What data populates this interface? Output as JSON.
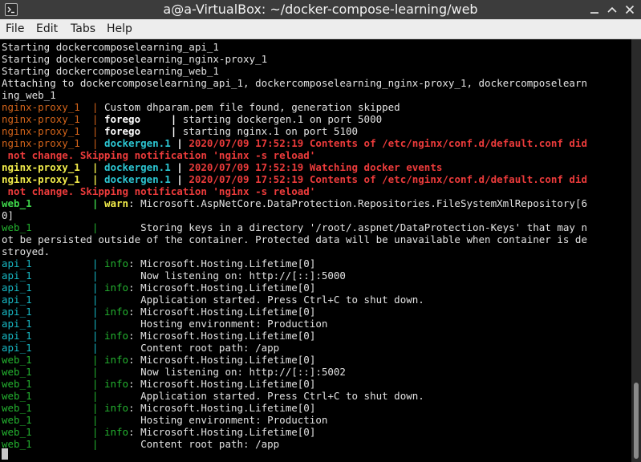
{
  "window": {
    "title": "a@a-VirtualBox: ~/docker-compose-learning/web"
  },
  "menu": {
    "file": "File",
    "edit": "Edit",
    "tabs": "Tabs",
    "help": "Help"
  },
  "icons": {
    "app": "terminal-icon",
    "minimize": "minimize-icon",
    "maximize": "maximize-icon",
    "close": "close-icon"
  },
  "colors": {
    "nginx_proxy_prefix": "#d4641a",
    "api_prefix": "#17b8c4",
    "web_prefix": "#23b12f",
    "error_text": "#ec3b3b",
    "highlight_yellow": "#f2ec4a"
  },
  "terminal": {
    "lines": [
      [
        {
          "t": "Starting dockercomposelearning_api_1",
          "c": "white"
        }
      ],
      [
        {
          "t": "Starting dockercomposelearning_nginx-proxy_1",
          "c": "white"
        }
      ],
      [
        {
          "t": "Starting dockercomposelearning_web_1",
          "c": "white"
        }
      ],
      [
        {
          "t": "Attaching to dockercomposelearning_api_1, dockercomposelearning_nginx-proxy_1, dockercomposelearn",
          "c": "white"
        }
      ],
      [
        {
          "t": "ing_web_1",
          "c": "white"
        }
      ],
      [
        {
          "t": "nginx-proxy_1  | ",
          "c": "orange"
        },
        {
          "t": "Custom dhparam.pem file found, generation skipped",
          "c": "white"
        }
      ],
      [
        {
          "t": "nginx-proxy_1  | ",
          "c": "orange"
        },
        {
          "t": "forego",
          "c": "whiteb"
        },
        {
          "t": "     | ",
          "c": "whiteb"
        },
        {
          "t": "starting dockergen.1 on port 5000",
          "c": "white"
        }
      ],
      [
        {
          "t": "nginx-proxy_1  | ",
          "c": "orange"
        },
        {
          "t": "forego",
          "c": "whiteb"
        },
        {
          "t": "     | ",
          "c": "whiteb"
        },
        {
          "t": "starting nginx.1 on port 5100",
          "c": "white"
        }
      ],
      [
        {
          "t": "nginx-proxy_1  | ",
          "c": "orange"
        },
        {
          "t": "dockergen.1",
          "c": "cyanb"
        },
        {
          "t": " | ",
          "c": "whiteb"
        },
        {
          "t": "2020/07/09 17:52:19 Contents of /etc/nginx/conf.d/default.conf did",
          "c": "red"
        }
      ],
      [
        {
          "t": " not change. Skipping notification 'nginx -s reload'",
          "c": "red"
        }
      ],
      [
        {
          "t": "nginx-proxy_1  | ",
          "c": "yellow"
        },
        {
          "t": "dockergen.1",
          "c": "cyanb"
        },
        {
          "t": " | ",
          "c": "whiteb"
        },
        {
          "t": "2020/07/09 17:52:19 Watching docker events",
          "c": "red"
        }
      ],
      [
        {
          "t": "nginx-proxy_1  | ",
          "c": "yellow"
        },
        {
          "t": "dockergen.1",
          "c": "cyanb"
        },
        {
          "t": " | ",
          "c": "whiteb"
        },
        {
          "t": "2020/07/09 17:52:19 Contents of /etc/nginx/conf.d/default.conf did",
          "c": "red"
        }
      ],
      [
        {
          "t": " not change. Skipping notification 'nginx -s reload'",
          "c": "red"
        }
      ],
      [
        {
          "t": "web_1          | ",
          "c": "greenb"
        },
        {
          "t": "warn",
          "c": "yellow"
        },
        {
          "t": ": Microsoft.AspNetCore.DataProtection.Repositories.FileSystemXmlRepository[6",
          "c": "white"
        }
      ],
      [
        {
          "t": "0]",
          "c": "white"
        }
      ],
      [
        {
          "t": "web_1          | ",
          "c": "green"
        },
        {
          "t": "      Storing keys in a directory '/root/.aspnet/DataProtection-Keys' that may n",
          "c": "white"
        }
      ],
      [
        {
          "t": "ot be persisted outside of the container. Protected data will be unavailable when container is de",
          "c": "white"
        }
      ],
      [
        {
          "t": "stroyed.",
          "c": "white"
        }
      ],
      [
        {
          "t": "api_1          | ",
          "c": "cyan"
        },
        {
          "t": "info",
          "c": "green"
        },
        {
          "t": ": Microsoft.Hosting.Lifetime[0]",
          "c": "white"
        }
      ],
      [
        {
          "t": "api_1          | ",
          "c": "cyan"
        },
        {
          "t": "      Now listening on: http://[::]:5000",
          "c": "white"
        }
      ],
      [
        {
          "t": "api_1          | ",
          "c": "cyan"
        },
        {
          "t": "info",
          "c": "green"
        },
        {
          "t": ": Microsoft.Hosting.Lifetime[0]",
          "c": "white"
        }
      ],
      [
        {
          "t": "api_1          | ",
          "c": "cyan"
        },
        {
          "t": "      Application started. Press Ctrl+C to shut down.",
          "c": "white"
        }
      ],
      [
        {
          "t": "api_1          | ",
          "c": "cyan"
        },
        {
          "t": "info",
          "c": "green"
        },
        {
          "t": ": Microsoft.Hosting.Lifetime[0]",
          "c": "white"
        }
      ],
      [
        {
          "t": "api_1          | ",
          "c": "cyan"
        },
        {
          "t": "      Hosting environment: Production",
          "c": "white"
        }
      ],
      [
        {
          "t": "api_1          | ",
          "c": "cyan"
        },
        {
          "t": "info",
          "c": "green"
        },
        {
          "t": ": Microsoft.Hosting.Lifetime[0]",
          "c": "white"
        }
      ],
      [
        {
          "t": "api_1          | ",
          "c": "cyan"
        },
        {
          "t": "      Content root path: /app",
          "c": "white"
        }
      ],
      [
        {
          "t": "web_1          | ",
          "c": "green"
        },
        {
          "t": "info",
          "c": "green"
        },
        {
          "t": ": Microsoft.Hosting.Lifetime[0]",
          "c": "white"
        }
      ],
      [
        {
          "t": "web_1          | ",
          "c": "green"
        },
        {
          "t": "      Now listening on: http://[::]:5002",
          "c": "white"
        }
      ],
      [
        {
          "t": "web_1          | ",
          "c": "green"
        },
        {
          "t": "info",
          "c": "green"
        },
        {
          "t": ": Microsoft.Hosting.Lifetime[0]",
          "c": "white"
        }
      ],
      [
        {
          "t": "web_1          | ",
          "c": "green"
        },
        {
          "t": "      Application started. Press Ctrl+C to shut down.",
          "c": "white"
        }
      ],
      [
        {
          "t": "web_1          | ",
          "c": "green"
        },
        {
          "t": "info",
          "c": "green"
        },
        {
          "t": ": Microsoft.Hosting.Lifetime[0]",
          "c": "white"
        }
      ],
      [
        {
          "t": "web_1          | ",
          "c": "green"
        },
        {
          "t": "      Hosting environment: Production",
          "c": "white"
        }
      ],
      [
        {
          "t": "web_1          | ",
          "c": "green"
        },
        {
          "t": "info",
          "c": "green"
        },
        {
          "t": ": Microsoft.Hosting.Lifetime[0]",
          "c": "white"
        }
      ],
      [
        {
          "t": "web_1          | ",
          "c": "green"
        },
        {
          "t": "      Content root path: /app",
          "c": "white"
        }
      ]
    ]
  }
}
